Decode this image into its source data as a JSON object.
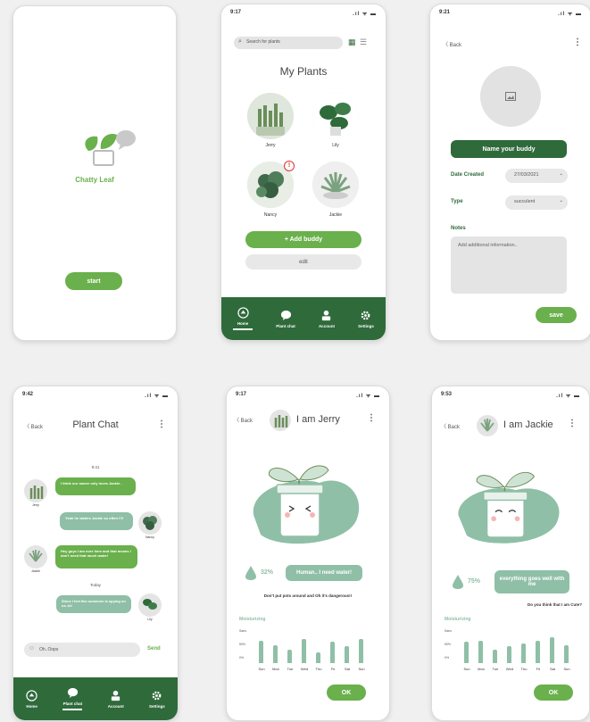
{
  "colors": {
    "primary_dark": "#2f6a3b",
    "primary": "#6ab04c",
    "sage": "#8fbfa7",
    "grey": "#e4e4e4"
  },
  "splash": {
    "app_name": "Chatty Leaf",
    "start_label": "start"
  },
  "myplants": {
    "time": "9:17",
    "search_placeholder": "Search for plants",
    "title": "My Plants",
    "plants": [
      {
        "name": "Jerry"
      },
      {
        "name": "Lily"
      },
      {
        "name": "Nancy"
      },
      {
        "name": "Jackie"
      }
    ],
    "alert": "!",
    "add_label": "+ Add buddy",
    "edit_label": "edit"
  },
  "nav": {
    "items": [
      "Home",
      "Plant chat",
      "Account",
      "Settings"
    ]
  },
  "addbuddy": {
    "time": "9:21",
    "back": "Back",
    "name_label": "Name your buddy",
    "date_label": "Date Created",
    "date_value": "27/03/2021",
    "type_label": "Type",
    "type_value": "succulent",
    "notes_label": "Notes",
    "notes_placeholder": "Add additional information..",
    "save_label": "save"
  },
  "chat": {
    "time": "9:42",
    "back": "Back",
    "title": "Plant Chat",
    "day1": "9:41",
    "day2": "Today",
    "messages": [
      {
        "text": "I think our owner only loves Jackie..",
        "who": "Jerry"
      },
      {
        "text": "Yeah he waters Jackie so often !!!!",
        "who": "Nancy"
      },
      {
        "text": "Hey guys I am over here and that means I don't need that much water!",
        "who": "Jackie"
      },
      {
        "text": "Since I feel like someone is spying on us..lol",
        "who": "Lily"
      }
    ],
    "input_value": "Oh..Oops",
    "send_label": "Send"
  },
  "jerry": {
    "time": "9:17",
    "back": "Back",
    "title": "I am Jerry",
    "percent": "32%",
    "message": "Human.. I need water!",
    "question": "Don't put pots around and Oh it's dangerous!!",
    "section": "Moisturizing",
    "ylabels": [
      "Sans",
      "50%",
      "0%"
    ],
    "days": [
      "Sun",
      "Mon",
      "Tue",
      "Wed",
      "Thu",
      "Fri",
      "Sat",
      "Sun"
    ],
    "values": [
      0.75,
      0.6,
      0.45,
      0.8,
      0.35,
      0.7,
      0.55,
      0.8
    ],
    "ok_label": "OK"
  },
  "jackie": {
    "time": "9:53",
    "back": "Back",
    "title": "I am Jackie",
    "percent": "75%",
    "message": "everything goes well with me",
    "question": "Do you think that I am Cute?",
    "section": "Moisturizing",
    "ylabels": [
      "Sans",
      "50%",
      "0%"
    ],
    "days": [
      "Sun",
      "Mon",
      "Tue",
      "Wed",
      "Thu",
      "Fri",
      "Sat",
      "Sun"
    ],
    "values": [
      0.7,
      0.75,
      0.45,
      0.55,
      0.65,
      0.75,
      0.85,
      0.6
    ],
    "ok_label": "OK"
  }
}
